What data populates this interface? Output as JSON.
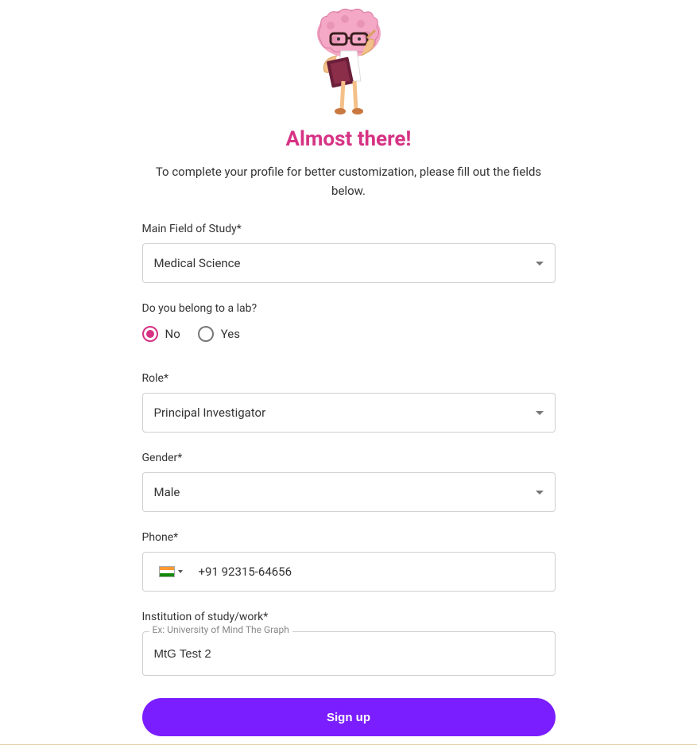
{
  "header": {
    "title": "Almost there!",
    "subtitle": "To complete your profile for better customization, please fill out the fields below."
  },
  "fields": {
    "mainField": {
      "label": "Main Field of Study*",
      "value": "Medical Science"
    },
    "lab": {
      "label": "Do you belong to a lab?",
      "options": {
        "no": "No",
        "yes": "Yes"
      },
      "selected": "no"
    },
    "role": {
      "label": "Role*",
      "value": "Principal Investigator"
    },
    "gender": {
      "label": "Gender*",
      "value": "Male"
    },
    "phone": {
      "label": "Phone*",
      "country": "India",
      "value": "+91 92315-64656"
    },
    "institution": {
      "label": "Institution of study/work*",
      "placeholder": "Ex: University of Mind The Graph",
      "value": "MtG Test 2"
    }
  },
  "actions": {
    "signup": "Sign up"
  }
}
